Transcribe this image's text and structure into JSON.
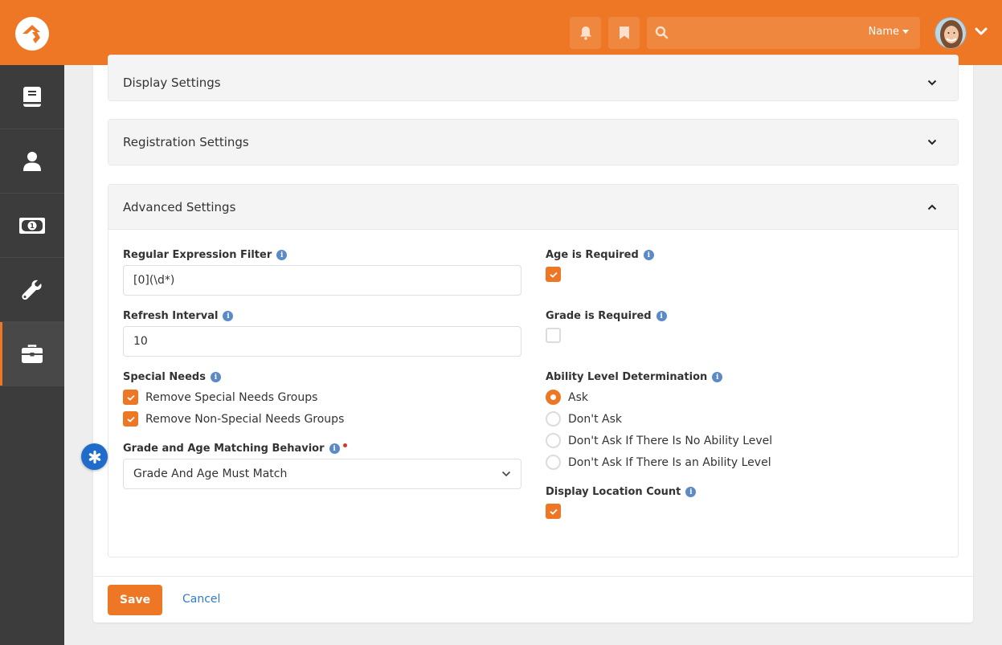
{
  "header": {
    "search_placeholder": "",
    "search_filter_label": "Name",
    "icons": [
      "logo-icon",
      "bell-icon",
      "bookmark-icon",
      "search-icon",
      "avatar",
      "chevron-down-icon"
    ]
  },
  "sidebar": {
    "items": [
      {
        "name": "book-icon",
        "active": false
      },
      {
        "name": "person-icon",
        "active": false
      },
      {
        "name": "money-icon",
        "active": false
      },
      {
        "name": "wrench-icon",
        "active": false
      },
      {
        "name": "briefcase-icon",
        "active": true
      }
    ]
  },
  "panels": {
    "display": {
      "title": "Display Settings",
      "expanded": false
    },
    "registration": {
      "title": "Registration Settings",
      "expanded": false
    },
    "advanced": {
      "title": "Advanced Settings",
      "expanded": true
    }
  },
  "advanced": {
    "regex_filter": {
      "label": "Regular Expression Filter",
      "value": "[0](\\d*)"
    },
    "refresh_interval": {
      "label": "Refresh Interval",
      "value": "10"
    },
    "special_needs": {
      "label": "Special Needs",
      "options": [
        {
          "label": "Remove Special Needs Groups",
          "checked": true
        },
        {
          "label": "Remove Non-Special Needs Groups",
          "checked": true
        }
      ]
    },
    "grade_age_matching": {
      "label": "Grade and Age Matching Behavior",
      "required": true,
      "value": "Grade And Age Must Match"
    },
    "age_required": {
      "label": "Age is Required",
      "checked": true
    },
    "grade_required": {
      "label": "Grade is Required",
      "checked": false
    },
    "ability_level": {
      "label": "Ability Level Determination",
      "selected": "Ask",
      "options": [
        "Ask",
        "Don't Ask",
        "Don't Ask If There Is No Ability Level",
        "Don't Ask If There Is an Ability Level"
      ]
    },
    "display_location_count": {
      "label": "Display Location Count",
      "checked": true
    }
  },
  "actions": {
    "save_label": "Save",
    "cancel_label": "Cancel"
  },
  "colors": {
    "brand": "#ee7725",
    "sidebar": "#3c3c3c",
    "link": "#2f7bc4",
    "info": "#5b8ac7",
    "fab": "#1f6ccb"
  }
}
